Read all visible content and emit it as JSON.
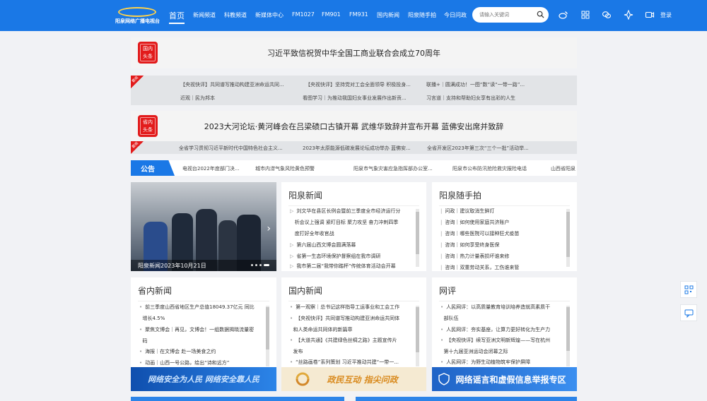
{
  "nav": {
    "logo_text": "阳泉网络广播电视台",
    "items": [
      "首页",
      "新闻频道",
      "科教频道",
      "新媒体中心",
      "FM1027",
      "FM901",
      "FM931",
      "国内新闻",
      "阳泉随手拍",
      "今日问政"
    ],
    "search_placeholder": "请输入关键词",
    "login": "登录"
  },
  "headline1": {
    "badge": [
      "国内",
      "头条"
    ],
    "text": "习近平致信祝贺中华全国工商业联合会成立70周年"
  },
  "sub1": {
    "ribbon": "要闻",
    "links": [
      "【央视快评】共同谱写推动构建亚洲命运共同...",
      "【央视快评】坚持党对工会全面领导 积极投身...",
      "联播+｜圆满成功！一图“数”读“一带一路”...",
      "近观｜民为邦本",
      "看图学习｜为推动我国妇女事业发展作出新贡...",
      "习言道｜支持和帮助妇女享有出彩的人生"
    ]
  },
  "headline2": {
    "badge": [
      "省内",
      "头条"
    ],
    "text": "2023大河论坛·黄河峰会在吕梁碛口古镇开幕 武维华致辞并宣布开幕 蓝佛安出席并致辞"
  },
  "sub2": {
    "ribbon": "要闻",
    "links": [
      "全省学习贯彻习近平新时代中国特色社会主义...",
      "2023年太原能源低碳发展论坛成功举办 蓝佛安...",
      "全省开发区2023年第三次“三个一批”活动举..."
    ]
  },
  "notice": {
    "tag": "公告",
    "items": [
      "电视台2022年度部门决...",
      "城市内涝气象风险黄色预警",
      "阳泉市气象灾害应急指挥部办公室...",
      "阳泉市公布防汛抢险救灾报险电话",
      "山西省阳泉"
    ]
  },
  "photo": {
    "caption": "阳泉新闻2023年10月21日"
  },
  "yq_news": {
    "title": "阳泉新闻",
    "items": [
      [
        "刘文华在县区长例会暨前三季度全市经济运行分",
        "析会议上强调 紧盯目标 聚力攻坚 奋力冲刺四季",
        "度打好全年收官战"
      ],
      [
        "第六届山西文博会圆满落幕"
      ],
      [
        "省第一生态环境保护督察组在我市调研"
      ],
      [
        "我市第二届“我带你踏杯”传统体育活动会开幕"
      ]
    ]
  },
  "snap": {
    "title": "阳泉随手拍",
    "items": [
      "问政｜建议取消生鲜灯",
      "咨询｜如何使用家庭共济账户",
      "咨询｜哪些医院可以接种狂犬疫苗",
      "咨询｜如何享受终身医保",
      "咨询｜热力计量表损坏谁来修",
      "咨询｜双重劳动关系，工伤谁来管"
    ]
  },
  "province": {
    "title": "省内新闻",
    "items": [
      [
        "前三季度山西省地区生产总值18049.37亿元 同比",
        "增长4.5%"
      ],
      [
        "聚焦文博会｜再见，文博会！一组数据揭晓流量密",
        "码"
      ],
      [
        "海报｜在文博会 赴一场美食之约"
      ],
      [
        "动画｜山西一号公路，绘出“诗和远方”"
      ]
    ]
  },
  "domestic": {
    "title": "国内新闻",
    "items": [
      [
        "第一观察｜总书记这样指导工运事业和工会工作"
      ],
      [
        "【央视快评】共同谱写推动构建亚洲命运共同体",
        "和人类命运共同体的新篇章"
      ],
      [
        "【大道共通】《共建绿色丝绸之路》主题宣传片",
        "发布"
      ],
      [
        "“丝路画卷”系列策划 习近平推动共建“一带一..."
      ]
    ]
  },
  "review": {
    "title": "网评",
    "items": [
      [
        "人民网评：以高质量教育培训培养造就高素质干",
        "部队伍"
      ],
      [
        "人民网评：夯实基座，让算力更好转化为生产力"
      ],
      [
        "【央视快评】续写亚洲文明新辉煌——写在杭州",
        "第十九届亚洲运动会闭幕之际"
      ],
      [
        "人民网评：为野生动植物筑牢保护屏障"
      ]
    ]
  },
  "banners": [
    "网络安全为人民 网络安全靠人民",
    "政民互动 指尖问政",
    "网络谣言和虚假信息举报专区"
  ],
  "colors": {
    "brand": "#1a78e6",
    "badge": "#e21b1b"
  }
}
